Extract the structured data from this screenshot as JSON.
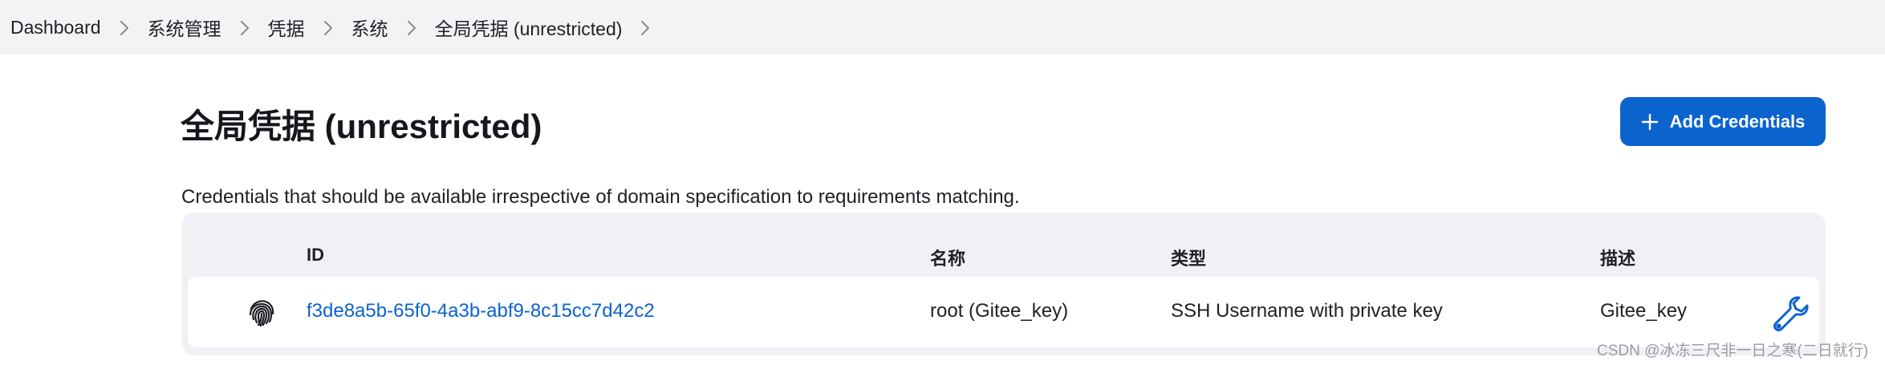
{
  "breadcrumb": {
    "items": [
      {
        "label": "Dashboard"
      },
      {
        "label": "系统管理"
      },
      {
        "label": "凭据"
      },
      {
        "label": "系统"
      },
      {
        "label": "全局凭据 (unrestricted)"
      }
    ]
  },
  "header": {
    "title": "全局凭据 (unrestricted)",
    "add_button_label": "Add Credentials",
    "add_button_icon": "plus-icon",
    "accent_color": "#0b63ce"
  },
  "description": "Credentials that should be available irrespective of domain specification to requirements matching.",
  "table": {
    "columns": [
      "ID",
      "名称",
      "类型",
      "描述"
    ],
    "rows": [
      {
        "icon": "fingerprint-icon",
        "id": "f3de8a5b-65f0-4a3b-abf9-8c15cc7d42c2",
        "name": "root (Gitee_key)",
        "type": "SSH Username with private key",
        "description": "Gitee_key",
        "action_icon": "wrench-icon"
      }
    ]
  },
  "watermark": "CSDN @冰冻三尺非一日之寒(二日就行)"
}
